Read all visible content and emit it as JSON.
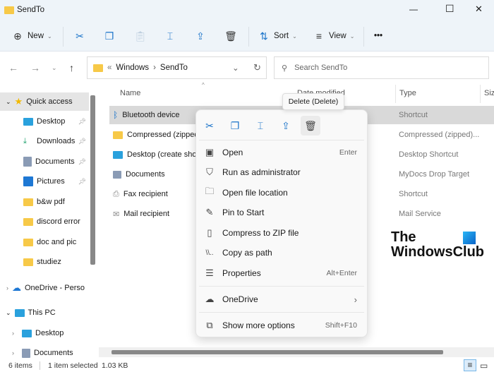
{
  "window": {
    "title": "SendTo",
    "minimize": "—",
    "maximize": "☐",
    "close": "✕"
  },
  "toolbar": {
    "new_label": "New",
    "sort_label": "Sort",
    "view_label": "View",
    "more": "•••"
  },
  "address": {
    "prefix": "«",
    "crumbs": [
      "Windows",
      "SendTo"
    ],
    "sep": "›"
  },
  "search": {
    "placeholder": "Search SendTo"
  },
  "nav": {
    "quick_access": "Quick access",
    "items": [
      {
        "label": "Desktop",
        "pinned": true
      },
      {
        "label": "Downloads",
        "pinned": true
      },
      {
        "label": "Documents",
        "pinned": true
      },
      {
        "label": "Pictures",
        "pinned": true
      },
      {
        "label": "b&w pdf"
      },
      {
        "label": "discord error"
      },
      {
        "label": "doc and pic"
      },
      {
        "label": "studiez"
      }
    ],
    "onedrive": "OneDrive - Perso",
    "this_pc": "This PC",
    "pc_items": [
      "Desktop",
      "Documents"
    ]
  },
  "columns": {
    "name": "Name",
    "date": "Date modified",
    "type": "Type",
    "size": "Size"
  },
  "files": [
    {
      "name": "Bluetooth device",
      "type": "Shortcut",
      "selected": true
    },
    {
      "name": "Compressed (zipped)",
      "type": "Compressed (zipped)..."
    },
    {
      "name": "Desktop (create shortcut)",
      "type": "Desktop Shortcut"
    },
    {
      "name": "Documents",
      "type": "MyDocs Drop Target"
    },
    {
      "name": "Fax recipient",
      "type": "Shortcut"
    },
    {
      "name": "Mail recipient",
      "type": "Mail Service"
    }
  ],
  "tooltip": "Delete (Delete)",
  "menu": {
    "items": [
      {
        "label": "Open",
        "shortcut": "Enter"
      },
      {
        "label": "Run as administrator",
        "shortcut": ""
      },
      {
        "label": "Open file location",
        "shortcut": ""
      },
      {
        "label": "Pin to Start",
        "shortcut": ""
      },
      {
        "label": "Compress to ZIP file",
        "shortcut": ""
      },
      {
        "label": "Copy as path",
        "shortcut": ""
      },
      {
        "label": "Properties",
        "shortcut": "Alt+Enter"
      },
      {
        "label": "OneDrive",
        "shortcut": "›"
      },
      {
        "label": "Show more options",
        "shortcut": "Shift+F10"
      }
    ]
  },
  "watermark": {
    "line1": "The",
    "line2": "WindowsClub"
  },
  "status": {
    "count": "6 items",
    "selected": "1 item selected",
    "size": "1.03 KB"
  }
}
